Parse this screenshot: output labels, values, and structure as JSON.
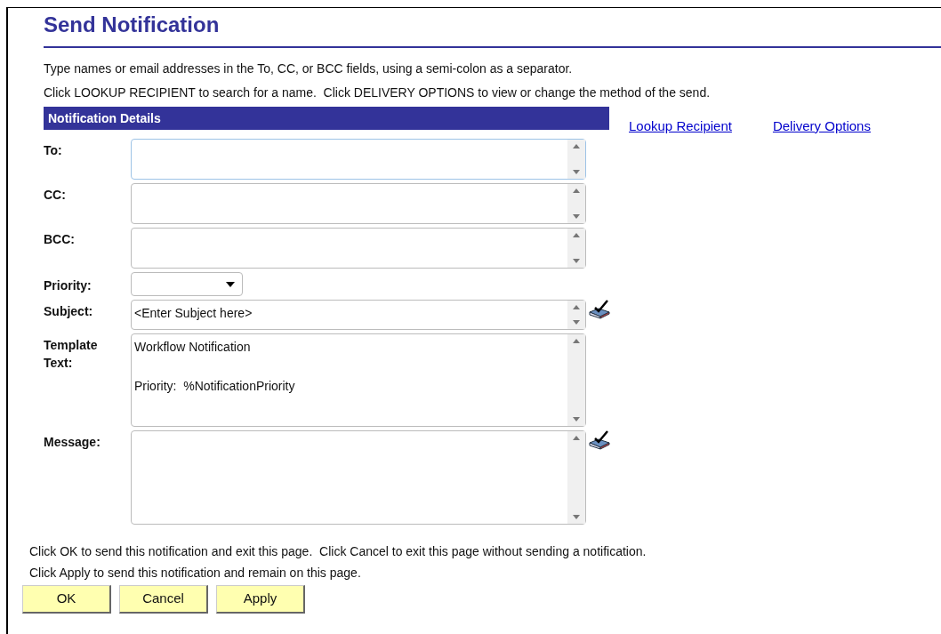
{
  "title": "Send Notification",
  "instructions": [
    "Type names or email addresses in the To, CC, or BCC fields, using a semi-colon as a separator.",
    "Click LOOKUP RECIPIENT to search for a name.  Click DELIVERY OPTIONS to view or change the method of the send."
  ],
  "section": {
    "title": "Notification Details"
  },
  "links": [
    "Lookup Recipient",
    "Delivery Options"
  ],
  "fields": [
    {
      "kind": "text",
      "label": "To:"
    },
    {
      "kind": "text",
      "label": "CC:"
    },
    {
      "kind": "text",
      "label": "BCC:"
    },
    {
      "kind": "select",
      "label": "Priority:"
    },
    {
      "kind": "text",
      "label": "Subject:",
      "value": "<Enter Subject here>",
      "spellcheck": true
    },
    {
      "kind": "text",
      "label": "Template Text:",
      "value": "Workflow Notification\n\nPriority:  %NotificationPriority"
    },
    {
      "kind": "text",
      "label": "Message:",
      "spellcheck": true
    }
  ],
  "footer": [
    "Click OK to send this notification and exit this page.  Click Cancel to exit this page without sending a notification.",
    "Click Apply to send this notification and remain on this page."
  ],
  "buttons": [
    "OK",
    "Cancel",
    "Apply"
  ]
}
